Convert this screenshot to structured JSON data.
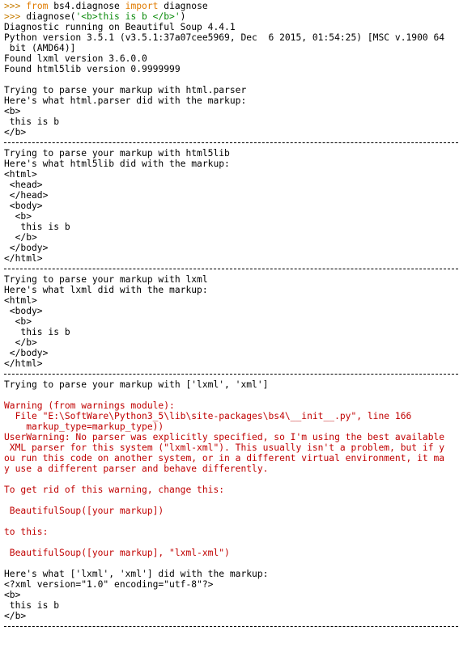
{
  "shell": {
    "prompt": ">>> ",
    "input_lines": [
      {
        "parts": [
          {
            "text": "from",
            "kind": "kw"
          },
          {
            "text": " bs4.diagnose ",
            "kind": "ident"
          },
          {
            "text": "import",
            "kind": "kw"
          },
          {
            "text": " diagnose",
            "kind": "ident"
          }
        ]
      },
      {
        "parts": [
          {
            "text": "diagnose(",
            "kind": "ident"
          },
          {
            "text": "'<b>this is b </b>'",
            "kind": "str"
          },
          {
            "text": ")",
            "kind": "ident"
          }
        ]
      }
    ],
    "output_lines": [
      {
        "text": "Diagnostic running on Beautiful Soup 4.4.1",
        "kind": "out"
      },
      {
        "text": "Python version 3.5.1 (v3.5.1:37a07cee5969, Dec  6 2015, 01:54:25) [MSC v.1900 64",
        "kind": "out"
      },
      {
        "text": " bit (AMD64)]",
        "kind": "out"
      },
      {
        "text": "Found lxml version 3.6.0.0",
        "kind": "out"
      },
      {
        "text": "Found html5lib version 0.9999999",
        "kind": "out"
      },
      {
        "text": "",
        "kind": "out"
      },
      {
        "text": "Trying to parse your markup with html.parser",
        "kind": "out"
      },
      {
        "text": "Here's what html.parser did with the markup:",
        "kind": "out"
      },
      {
        "text": "<b>",
        "kind": "out"
      },
      {
        "text": " this is b",
        "kind": "out"
      },
      {
        "text": "</b>",
        "kind": "out"
      },
      {
        "text": "",
        "kind": "sep"
      },
      {
        "text": "Trying to parse your markup with html5lib",
        "kind": "out"
      },
      {
        "text": "Here's what html5lib did with the markup:",
        "kind": "out"
      },
      {
        "text": "<html>",
        "kind": "out"
      },
      {
        "text": " <head>",
        "kind": "out"
      },
      {
        "text": " </head>",
        "kind": "out"
      },
      {
        "text": " <body>",
        "kind": "out"
      },
      {
        "text": "  <b>",
        "kind": "out"
      },
      {
        "text": "   this is b",
        "kind": "out"
      },
      {
        "text": "  </b>",
        "kind": "out"
      },
      {
        "text": " </body>",
        "kind": "out"
      },
      {
        "text": "</html>",
        "kind": "out"
      },
      {
        "text": "",
        "kind": "sep"
      },
      {
        "text": "Trying to parse your markup with lxml",
        "kind": "out"
      },
      {
        "text": "Here's what lxml did with the markup:",
        "kind": "out"
      },
      {
        "text": "<html>",
        "kind": "out"
      },
      {
        "text": " <body>",
        "kind": "out"
      },
      {
        "text": "  <b>",
        "kind": "out"
      },
      {
        "text": "   this is b",
        "kind": "out"
      },
      {
        "text": "  </b>",
        "kind": "out"
      },
      {
        "text": " </body>",
        "kind": "out"
      },
      {
        "text": "</html>",
        "kind": "out"
      },
      {
        "text": "",
        "kind": "sep"
      },
      {
        "text": "Trying to parse your markup with ['lxml', 'xml']",
        "kind": "out"
      },
      {
        "text": "",
        "kind": "out"
      },
      {
        "text": "Warning (from warnings module):",
        "kind": "stderr"
      },
      {
        "text": "  File \"E:\\SoftWare\\Python3_5\\lib\\site-packages\\bs4\\__init__.py\", line 166",
        "kind": "stderr"
      },
      {
        "text": "    markup_type=markup_type))",
        "kind": "stderr"
      },
      {
        "text": "UserWarning: No parser was explicitly specified, so I'm using the best available",
        "kind": "stderr"
      },
      {
        "text": " XML parser for this system (\"lxml-xml\"). This usually isn't a problem, but if y",
        "kind": "stderr"
      },
      {
        "text": "ou run this code on another system, or in a different virtual environment, it ma",
        "kind": "stderr"
      },
      {
        "text": "y use a different parser and behave differently.",
        "kind": "stderr"
      },
      {
        "text": "",
        "kind": "stderr"
      },
      {
        "text": "To get rid of this warning, change this:",
        "kind": "stderr"
      },
      {
        "text": "",
        "kind": "stderr"
      },
      {
        "text": " BeautifulSoup([your markup])",
        "kind": "stderr"
      },
      {
        "text": "",
        "kind": "stderr"
      },
      {
        "text": "to this:",
        "kind": "stderr"
      },
      {
        "text": "",
        "kind": "stderr"
      },
      {
        "text": " BeautifulSoup([your markup], \"lxml-xml\")",
        "kind": "stderr"
      },
      {
        "text": "",
        "kind": "out"
      },
      {
        "text": "Here's what ['lxml', 'xml'] did with the markup:",
        "kind": "out"
      },
      {
        "text": "<?xml version=\"1.0\" encoding=\"utf-8\"?>",
        "kind": "out"
      },
      {
        "text": "<b>",
        "kind": "out"
      },
      {
        "text": " this is b",
        "kind": "out"
      },
      {
        "text": "</b>",
        "kind": "out"
      },
      {
        "text": "",
        "kind": "sep"
      }
    ],
    "final_prompt": ">>> "
  },
  "colors": {
    "background": "#ffffff",
    "output": "#000000",
    "stderr": "#c00000",
    "prompt": "#c77c00",
    "keyword": "#e07b00",
    "string": "#0a8a0a"
  }
}
